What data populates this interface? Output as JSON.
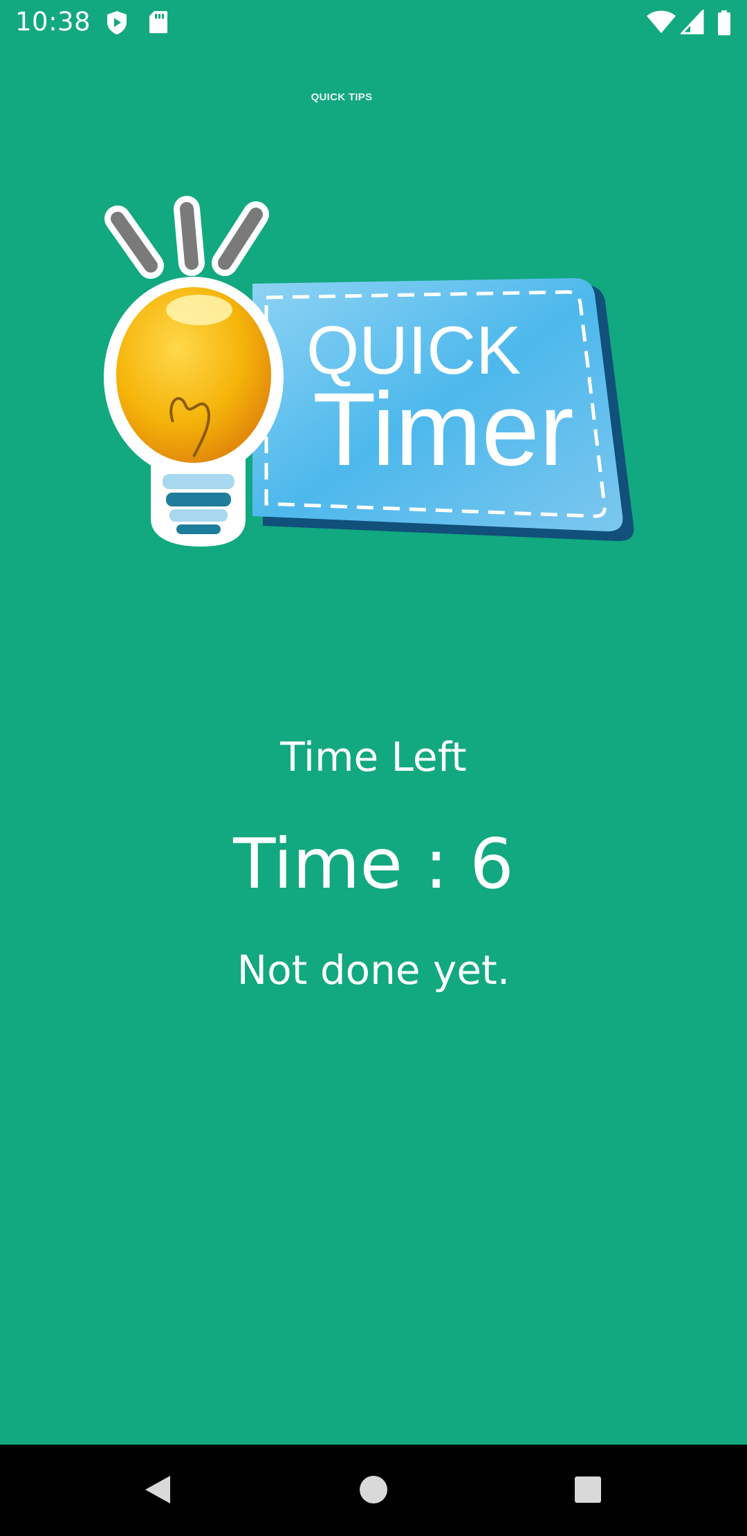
{
  "status_bar": {
    "time": "10:38",
    "left_icons": [
      "shield-play-icon",
      "sd-card-icon"
    ],
    "right_icons": [
      "wifi-icon",
      "cellular-signal-icon",
      "battery-icon"
    ]
  },
  "app": {
    "title": "QUICK TIPS",
    "logo": {
      "line1": "QUICK",
      "line2": "Timer"
    }
  },
  "timer": {
    "label": "Time Left",
    "value": "Time : 6",
    "message": "Not done yet."
  },
  "nav_bar": {
    "buttons": [
      "back-icon",
      "home-icon",
      "recents-icon"
    ]
  },
  "colors": {
    "background": "#12a880",
    "text": "#ffffff",
    "nav_bar": "#000000",
    "logo_card": "#5bbdeb",
    "bulb": "#f7b50a"
  }
}
